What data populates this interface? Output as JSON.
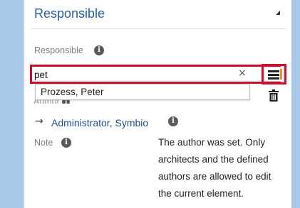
{
  "panel": {
    "title": "Responsible"
  },
  "responsible": {
    "label": "Responsible",
    "input_value": "pet",
    "clear_glyph": "×",
    "suggestions": [
      "Prozess, Peter"
    ]
  },
  "author": {
    "label": "Author",
    "arrow_glyph": "→",
    "value": "Administrator, Symbio"
  },
  "note": {
    "label": "Note",
    "text": "The author was set. Only architects and the defined authors are allowed to edit the current element."
  },
  "icons": {
    "info": "info-icon",
    "list": "list-icon",
    "trash": "trash-icon",
    "collapse": "collapse-icon"
  },
  "colors": {
    "highlight": "#c8102e",
    "title": "#2a5d9a",
    "link": "#1f4e8c",
    "accent": "#e8902a"
  }
}
